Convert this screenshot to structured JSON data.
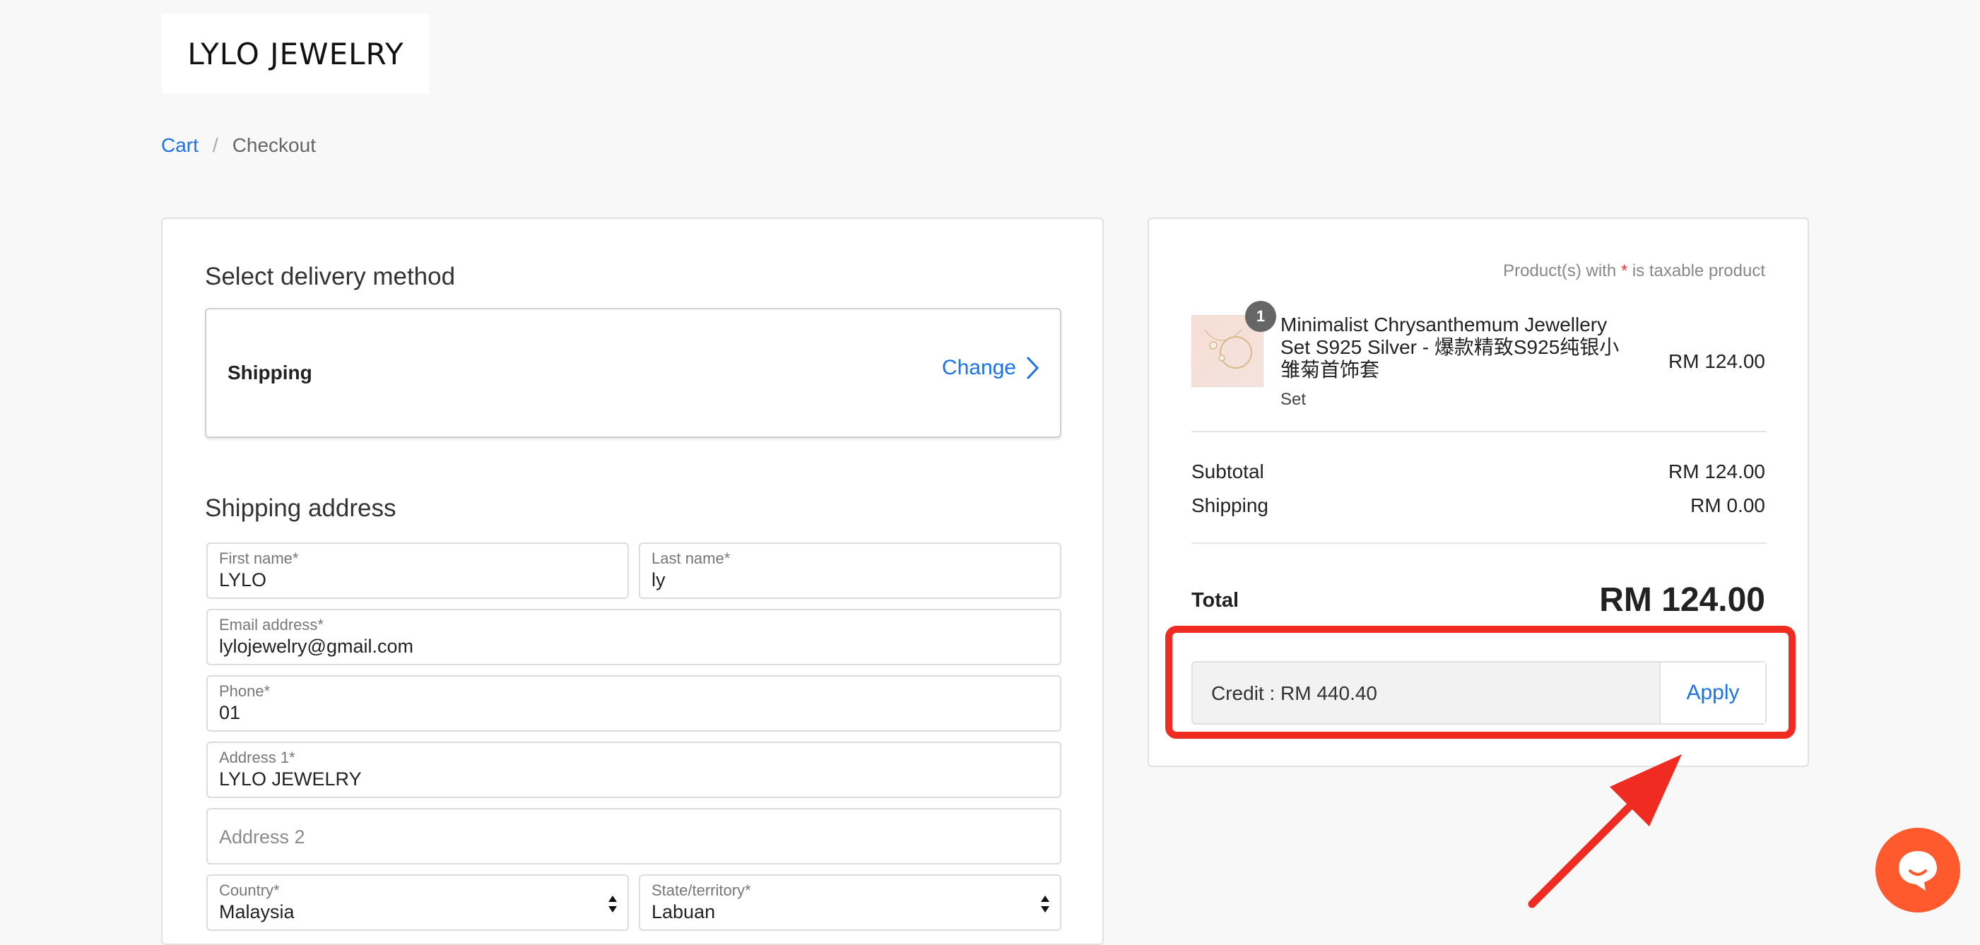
{
  "brand": {
    "logo_text": "LYLO JEWELRY"
  },
  "breadcrumb": {
    "cart": "Cart",
    "separator": "/",
    "current": "Checkout"
  },
  "delivery": {
    "title": "Select delivery method",
    "method": "Shipping",
    "change_label": "Change"
  },
  "shipping_address": {
    "title": "Shipping address",
    "fields": {
      "first_name": {
        "label": "First name*",
        "value": "LYLO"
      },
      "last_name": {
        "label": "Last name*",
        "value": "ly"
      },
      "email": {
        "label": "Email address*",
        "value": "lylojewelry@gmail.com"
      },
      "phone": {
        "label": "Phone*",
        "value": "01"
      },
      "address1": {
        "label": "Address 1*",
        "value": "LYLO JEWELRY"
      },
      "address2": {
        "placeholder": "Address 2"
      },
      "country": {
        "label": "Country*",
        "value": "Malaysia"
      },
      "state": {
        "label": "State/territory*",
        "value": "Labuan"
      }
    }
  },
  "summary": {
    "tax_note_prefix": "Product(s) with ",
    "tax_note_star": "*",
    "tax_note_suffix": " is taxable product",
    "item": {
      "quantity": "1",
      "name": "Minimalist Chrysanthemum Jewellery Set S925 Silver - 爆款精致S925纯银小雏菊首饰套",
      "variant": "Set",
      "price": "RM 124.00"
    },
    "subtotal_label": "Subtotal",
    "subtotal_value": "RM 124.00",
    "shipping_label": "Shipping",
    "shipping_value": "RM 0.00",
    "total_label": "Total",
    "total_value": "RM 124.00",
    "credit_text": "Credit : RM 440.40",
    "apply_label": "Apply"
  },
  "colors": {
    "accent": "#1a73e8",
    "highlight": "#f02b22",
    "chat": "#ff5a2d"
  },
  "icons": {
    "change": "chevron-right-icon",
    "select": "select-arrows-icon",
    "chat": "chat-icon",
    "annotation": "arrow-annotation"
  }
}
